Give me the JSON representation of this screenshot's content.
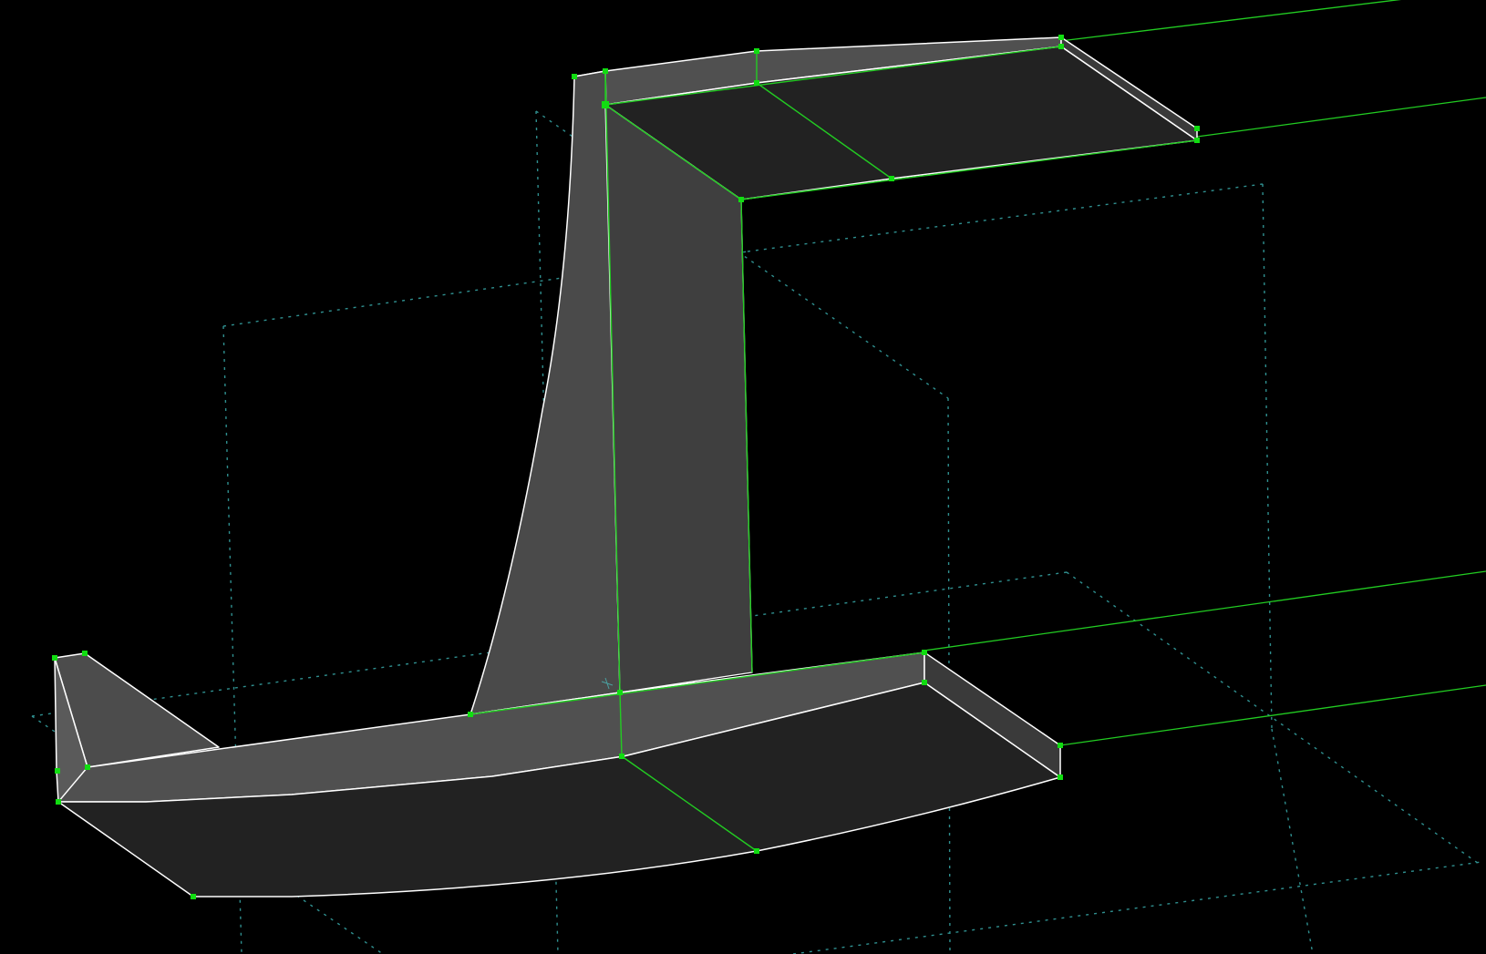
{
  "viewport": {
    "background": "#000000"
  },
  "colors": {
    "background": "#000000",
    "face_light": "#4f4f4f",
    "face_mid": "#404040",
    "face_dark": "#232323",
    "outline": "#ffffff",
    "selected_edge": "#22cc22",
    "vertex": "#11dd11",
    "guide": "#2f8f8f"
  },
  "scene": {
    "object": "mesh",
    "selected_vertex_count": 22,
    "guide_lines_style": "dotted"
  }
}
